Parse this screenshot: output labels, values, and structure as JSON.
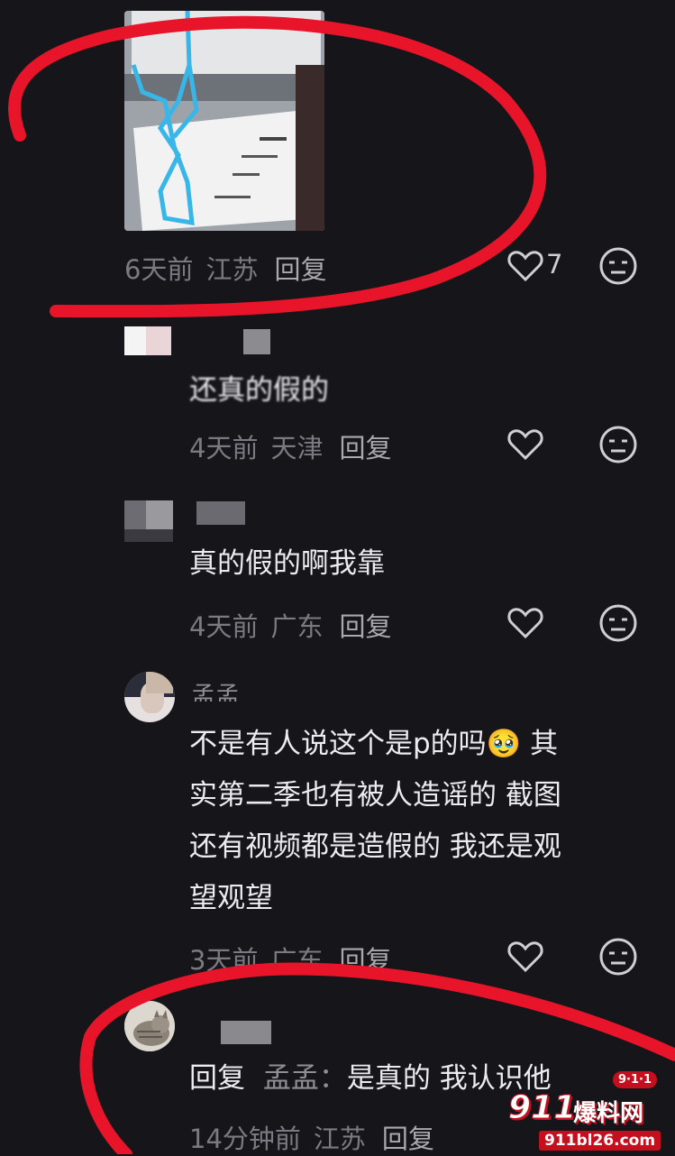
{
  "colors": {
    "background": "#16161a",
    "annotation": "#e8142a",
    "meta": "#7a7a80",
    "text": "#ececee"
  },
  "comments": [
    {
      "time": "6天前",
      "location": "江苏",
      "reply": "回复",
      "likes": "7",
      "has_image": true
    },
    {
      "name": "",
      "text": "还真的假的",
      "time": "4天前",
      "location": "天津",
      "reply": "回复"
    },
    {
      "name": "",
      "text": "真的假的啊我靠",
      "time": "4天前",
      "location": "广东",
      "reply": "回复"
    },
    {
      "name": "孟孟",
      "text_lines": [
        "不是有人说这个是p的吗🥹 其",
        "实第二季也有被人造谣的 截图",
        "还有视频都是造假的 我还是观",
        "望观望"
      ],
      "time": "3天前",
      "location": "广东",
      "reply": "回复"
    },
    {
      "name": "",
      "reply_prefix": "回复",
      "reply_to": "孟孟",
      "text": "是真的 我认识他",
      "time": "14分钟前",
      "location": "江苏",
      "reply": "回复"
    }
  ],
  "watermark": {
    "badge": "9·1·1",
    "brand_number": "911",
    "brand_text": "爆料网",
    "url": "911bl26.com"
  }
}
